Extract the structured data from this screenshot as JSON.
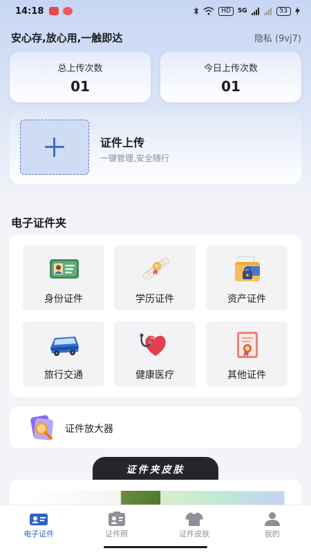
{
  "status_bar": {
    "time": "14:18",
    "network": "5G",
    "battery": "53"
  },
  "header": {
    "slogan": "安心存,放心用,一触即达",
    "privacy": "隐私 (9vj7)"
  },
  "stats": {
    "total_label": "总上传次数",
    "total_value": "01",
    "today_label": "今日上传次数",
    "today_value": "01"
  },
  "upload": {
    "title": "证件上传",
    "subtitle": "一键管理,安全随行"
  },
  "wallet": {
    "title": "电子证件夹",
    "items": [
      {
        "label": "身份证件",
        "icon": "id-card-icon"
      },
      {
        "label": "学历证件",
        "icon": "diploma-icon"
      },
      {
        "label": "资产证件",
        "icon": "asset-folder-icon"
      },
      {
        "label": "旅行交通",
        "icon": "bus-icon"
      },
      {
        "label": "健康医疗",
        "icon": "heart-stethoscope-icon"
      },
      {
        "label": "其他证件",
        "icon": "certificate-icon"
      }
    ]
  },
  "magnifier": {
    "label": "证件放大器",
    "icon": "magnifier-icon"
  },
  "skin_banner": {
    "label": "证件夹皮肤"
  },
  "tabbar": {
    "items": [
      {
        "label": "电子证件",
        "icon": "id-card-tab-icon",
        "active": true
      },
      {
        "label": "证件照",
        "icon": "photo-id-tab-icon",
        "active": false
      },
      {
        "label": "证件皮肤",
        "icon": "shirt-tab-icon",
        "active": false
      },
      {
        "label": "我的",
        "icon": "person-tab-icon",
        "active": false
      }
    ]
  },
  "colors": {
    "accent": "#2e63c9",
    "background": "#f3f4f8",
    "banner_dark": "#25262b"
  }
}
